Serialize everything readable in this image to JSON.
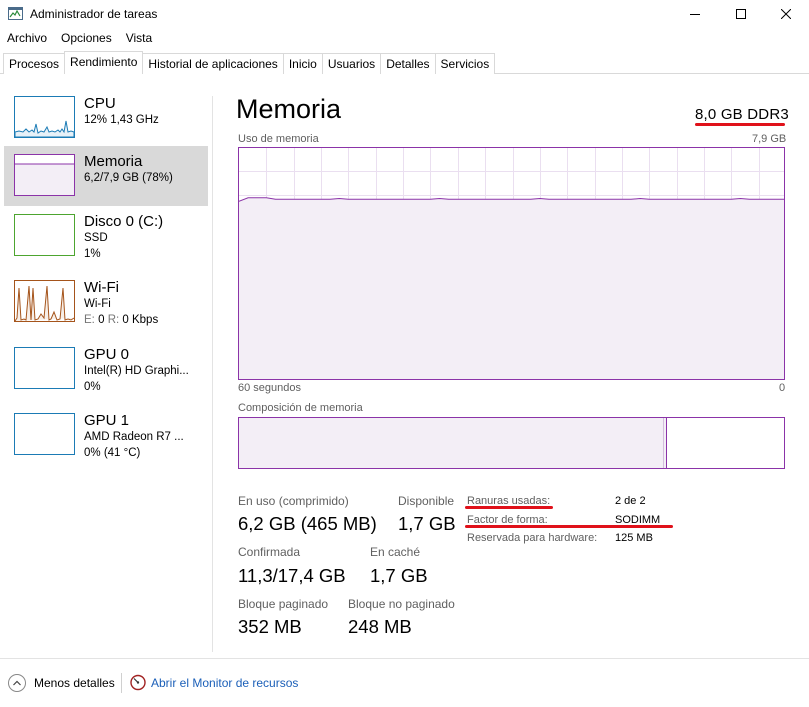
{
  "window": {
    "title": "Administrador de tareas"
  },
  "menu": [
    "Archivo",
    "Opciones",
    "Vista"
  ],
  "tabs": [
    "Procesos",
    "Rendimiento",
    "Historial de aplicaciones",
    "Inicio",
    "Usuarios",
    "Detalles",
    "Servicios"
  ],
  "active_tab": "Rendimiento",
  "sidebar": {
    "items": [
      {
        "name": "CPU",
        "sub1": "12% 1,43 GHz",
        "sub2": ""
      },
      {
        "name": "Memoria",
        "sub1": "6,2/7,9 GB (78%)",
        "sub2": ""
      },
      {
        "name": "Disco 0 (C:)",
        "sub1": "SSD",
        "sub2": "1%"
      },
      {
        "name": "Wi-Fi",
        "sub1": "Wi-Fi",
        "sub2_e_label": "E:",
        "sub2_e_value": "0",
        "sub2_r_label": "R:",
        "sub2_r_value": "0 Kbps"
      },
      {
        "name": "GPU 0",
        "sub1": "Intel(R) HD Graphi...",
        "sub2": "0%"
      },
      {
        "name": "GPU 1",
        "sub1": "AMD Radeon R7 ...",
        "sub2": "0% (41 °C)"
      }
    ],
    "selected_index": 1,
    "colors": {
      "cpu": "#1b7bb5",
      "memory": "#8b33a8",
      "disk": "#4da52f",
      "wifi": "#a5541b",
      "gpu": "#1b7bb5"
    }
  },
  "main": {
    "title": "Memoria",
    "spec": "8,0 GB DDR3",
    "usage_label": "Uso de memoria",
    "usage_max": "7,9 GB",
    "time_left": "60 segundos",
    "time_right": "0",
    "composition_label": "Composición de memoria",
    "stats": {
      "in_use_label": "En uso (comprimido)",
      "in_use_value": "6,2 GB (465 MB)",
      "available_label": "Disponible",
      "available_value": "1,7 GB",
      "committed_label": "Confirmada",
      "committed_value": "11,3/17,4 GB",
      "cached_label": "En caché",
      "cached_value": "1,7 GB",
      "paged_label": "Bloque paginado",
      "paged_value": "352 MB",
      "nonpaged_label": "Bloque no paginado",
      "nonpaged_value": "248 MB"
    },
    "details": {
      "slots_label": "Ranuras usadas:",
      "slots_value": "2 de 2",
      "form_label": "Factor de forma:",
      "form_value": "SODIMM",
      "reserved_label": "Reservada para hardware:",
      "reserved_value": "125 MB"
    },
    "usage_fraction": 0.78,
    "composition": {
      "in_use_fraction": 0.78,
      "modified_fraction": 0.005
    },
    "accent_color": "#8b33a8",
    "fill_color": "#f3eef6",
    "annotation_color": "#e0111a"
  },
  "footer": {
    "less_details": "Menos detalles",
    "open_monitor": "Abrir el Monitor de recursos"
  }
}
